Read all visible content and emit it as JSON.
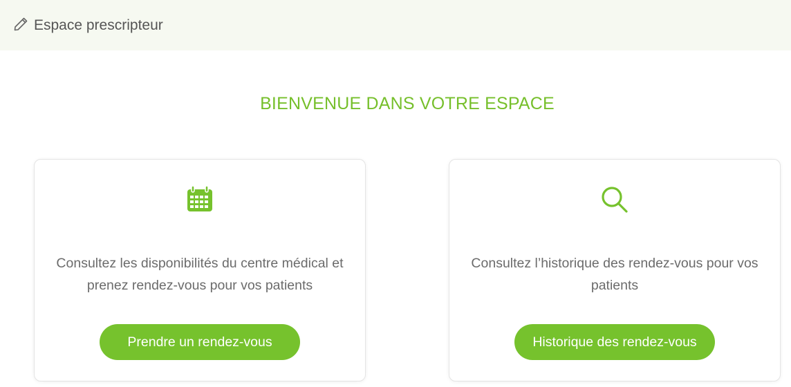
{
  "header": {
    "title": "Espace prescripteur",
    "icon": "pencil-icon"
  },
  "welcome": {
    "title": "BIENVENUE DANS VOTRE ESPACE"
  },
  "colors": {
    "accent": "#76c22d",
    "header_bg": "#f6f9f1"
  },
  "cards": [
    {
      "icon": "calendar-icon",
      "description": "Consultez les disponibilités du centre médical et prenez rendez-vous pour vos patients",
      "button_label": "Prendre un rendez-vous"
    },
    {
      "icon": "search-icon",
      "description": "Consultez l’historique des rendez-vous pour vos patients",
      "button_label": "Historique des rendez-vous"
    }
  ]
}
